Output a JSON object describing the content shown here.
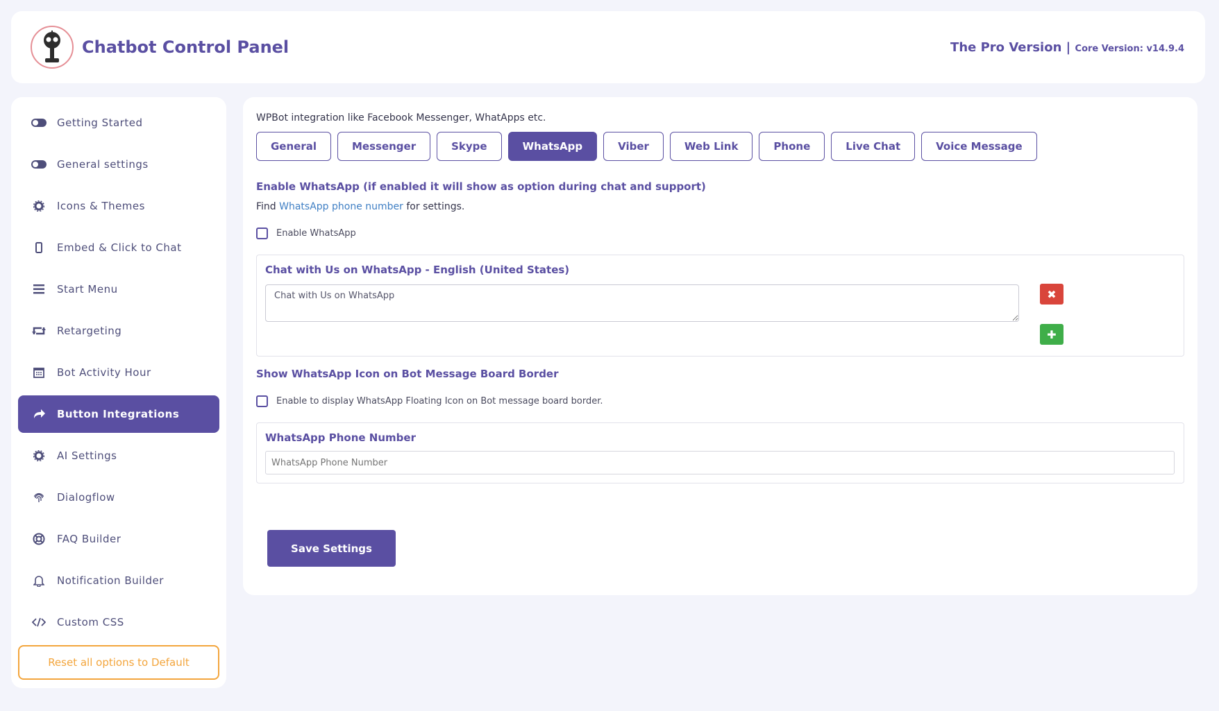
{
  "header": {
    "app_title": "Chatbot Control Panel",
    "version_label": "The Pro Version |",
    "core_version": "Core Version: v14.9.4"
  },
  "sidebar": {
    "items": [
      {
        "label": "Getting Started",
        "icon": "toggle-icon"
      },
      {
        "label": "General settings",
        "icon": "toggle-icon"
      },
      {
        "label": "Icons & Themes",
        "icon": "gear-icon"
      },
      {
        "label": "Embed & Click to Chat",
        "icon": "mobile-icon"
      },
      {
        "label": "Start Menu",
        "icon": "menu-icon"
      },
      {
        "label": "Retargeting",
        "icon": "retweet-icon"
      },
      {
        "label": "Bot Activity Hour",
        "icon": "calendar-icon"
      },
      {
        "label": "Button Integrations",
        "icon": "share-icon",
        "active": true
      },
      {
        "label": "AI Settings",
        "icon": "gear-icon"
      },
      {
        "label": "Dialogflow",
        "icon": "fingerprint-icon"
      },
      {
        "label": "FAQ Builder",
        "icon": "lifebuoy-icon"
      },
      {
        "label": "Notification Builder",
        "icon": "bell-icon"
      },
      {
        "label": "Custom CSS",
        "icon": "code-icon"
      }
    ],
    "reset_label": "Reset all options to Default"
  },
  "main": {
    "intro": "WPBot integration like Facebook Messenger, WhatApps etc.",
    "tabs": [
      "General",
      "Messenger",
      "Skype",
      "WhatsApp",
      "Viber",
      "Web Link",
      "Phone",
      "Live Chat",
      "Voice Message"
    ],
    "active_tab": "WhatsApp",
    "enable_title": "Enable WhatsApp (if enabled it will show as option during chat and support)",
    "help_prefix": "Find",
    "help_link": "WhatsApp phone number",
    "help_suffix": "for settings.",
    "enable_checkbox_label": "Enable WhatsApp",
    "chat_panel_title": "Chat with Us on WhatsApp - English (United States)",
    "chat_text_value": "Chat with Us on WhatsApp",
    "icon_section_title": "Show WhatsApp Icon on Bot Message Board Border",
    "icon_checkbox_label": "Enable to display WhatsApp Floating Icon on Bot message board border.",
    "phone_title": "WhatsApp Phone Number",
    "phone_placeholder": "WhatsApp Phone Number",
    "save_label": "Save Settings"
  },
  "colors": {
    "accent": "#5a4fa2",
    "reset": "#f3a53c",
    "remove": "#d9453b",
    "add": "#3fae49",
    "link": "#3f7fc4"
  }
}
